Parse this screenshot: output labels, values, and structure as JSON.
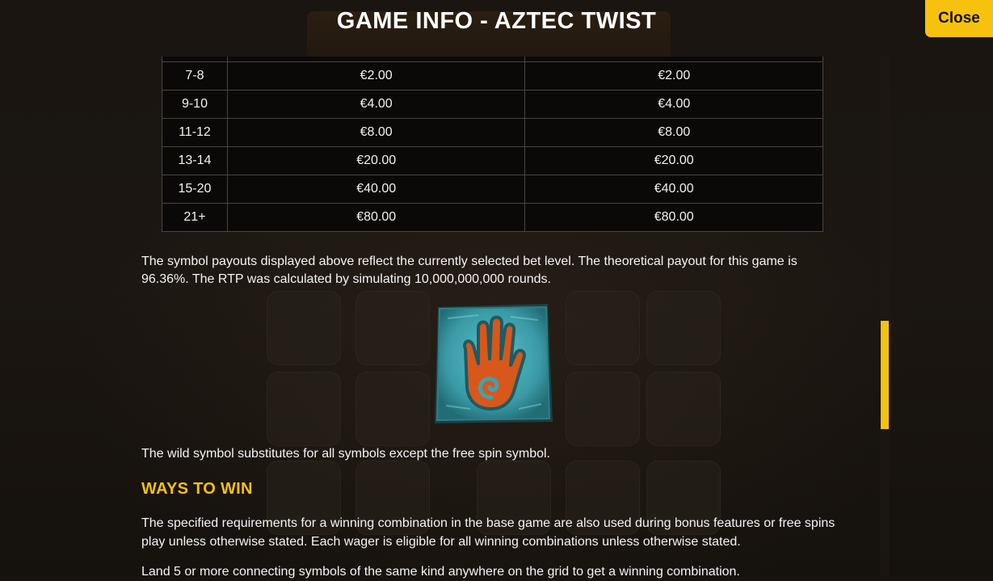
{
  "header": {
    "title": "GAME INFO - AZTEC TWIST",
    "close_label": "Close"
  },
  "paytable": {
    "rows": [
      {
        "count": "7-8",
        "value_a": "€2.00",
        "value_b": "€2.00"
      },
      {
        "count": "9-10",
        "value_a": "€4.00",
        "value_b": "€4.00"
      },
      {
        "count": "11-12",
        "value_a": "€8.00",
        "value_b": "€8.00"
      },
      {
        "count": "13-14",
        "value_a": "€20.00",
        "value_b": "€20.00"
      },
      {
        "count": "15-20",
        "value_a": "€40.00",
        "value_b": "€40.00"
      },
      {
        "count": "21+",
        "value_a": "€80.00",
        "value_b": "€80.00"
      }
    ]
  },
  "rtp_text": "The symbol payouts displayed above reflect the currently selected bet level. The theoretical payout for this game is 96.36%. The RTP was calculated by simulating 10,000,000,000 rounds.",
  "wild": {
    "icon": "wild-hand-spiral-icon",
    "description": "The wild symbol substitutes for all symbols except the free spin symbol."
  },
  "ways_to_win": {
    "title": "WAYS TO WIN",
    "paragraph_1": "The specified requirements for a winning combination in the base game are also used during bonus features or free spins play unless otherwise stated. Each wager is eligible for all winning combinations unless otherwise stated.",
    "paragraph_2": "Land 5 or more connecting symbols of the same kind anywhere on the grid to get a winning combination."
  },
  "colors": {
    "accent": "#f5c20c",
    "background": "#17130f",
    "table_bg": "#0b0908",
    "wild_stone": "#3fa3ad",
    "wild_hand": "#d8571a"
  }
}
